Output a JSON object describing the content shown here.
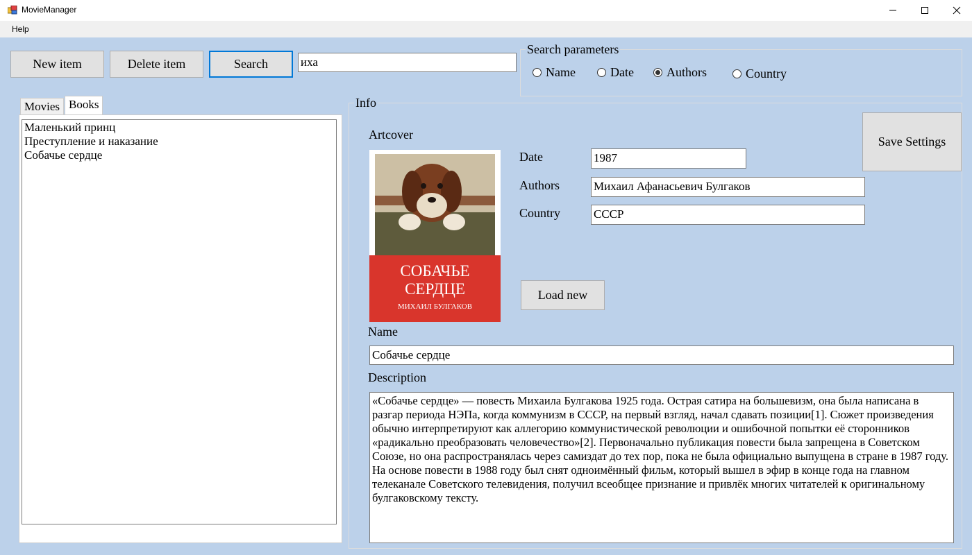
{
  "window": {
    "title": "MovieManager"
  },
  "menu": {
    "help": "Help"
  },
  "toolbar": {
    "new_item": "New item",
    "delete_item": "Delete item",
    "search": "Search",
    "search_value": "иха"
  },
  "search_params": {
    "title": "Search parameters",
    "options": [
      "Name",
      "Date",
      "Authors",
      "Country"
    ],
    "selected": "Authors"
  },
  "tabs": {
    "movies": "Movies",
    "books": "Books",
    "active": "Books"
  },
  "list": {
    "items": [
      "Маленький принц",
      "Преступление и наказание",
      "Собачье сердце"
    ]
  },
  "info": {
    "title": "Info",
    "artcover_label": "Artcover",
    "cover": {
      "title_line1": "СОБАЧЬЕ",
      "title_line2": "СЕРДЦЕ",
      "author": "МИХАИЛ БУЛГАКОВ"
    },
    "date_label": "Date",
    "date_value": "1987",
    "authors_label": "Authors",
    "authors_value": "Михаил Афанасьевич Булгаков",
    "country_label": "Country",
    "country_value": "СССР",
    "save_settings": "Save Settings",
    "load_new": "Load new",
    "name_label": "Name",
    "name_value": "Собачье сердце",
    "description_label": "Description",
    "description_value": "«Собачье сердце» — повесть Михаила Булгакова 1925 года. Острая сатира на большевизм, она была написана в разгар периода НЭПа, когда коммунизм в СССР, на первый взгляд, начал сдавать позиции[1]. Сюжет произведения обычно интерпретируют как аллегорию коммунистической революции и ошибочной попытки её сторонников «радикально преобразовать человечество»[2]. Первоначально публикация повести была запрещена в Советском Союзе, но она распространялась через самиздат до тех пор, пока не была официально выпущена в стране в 1987 году. На основе повести в 1988 году был снят одноимённый фильм, который вышел в эфир в конце года на главном телеканале Советского телевидения, получил всеобщее признание и привлёк многих читателей к оригинальному булгаковскому тексту."
  },
  "colors": {
    "form_bg": "#bcd1ea",
    "cover_red": "#d9352c",
    "focus_blue": "#0078d7"
  },
  "icons": [
    "app-icon",
    "minimize-icon",
    "maximize-icon",
    "close-icon"
  ]
}
